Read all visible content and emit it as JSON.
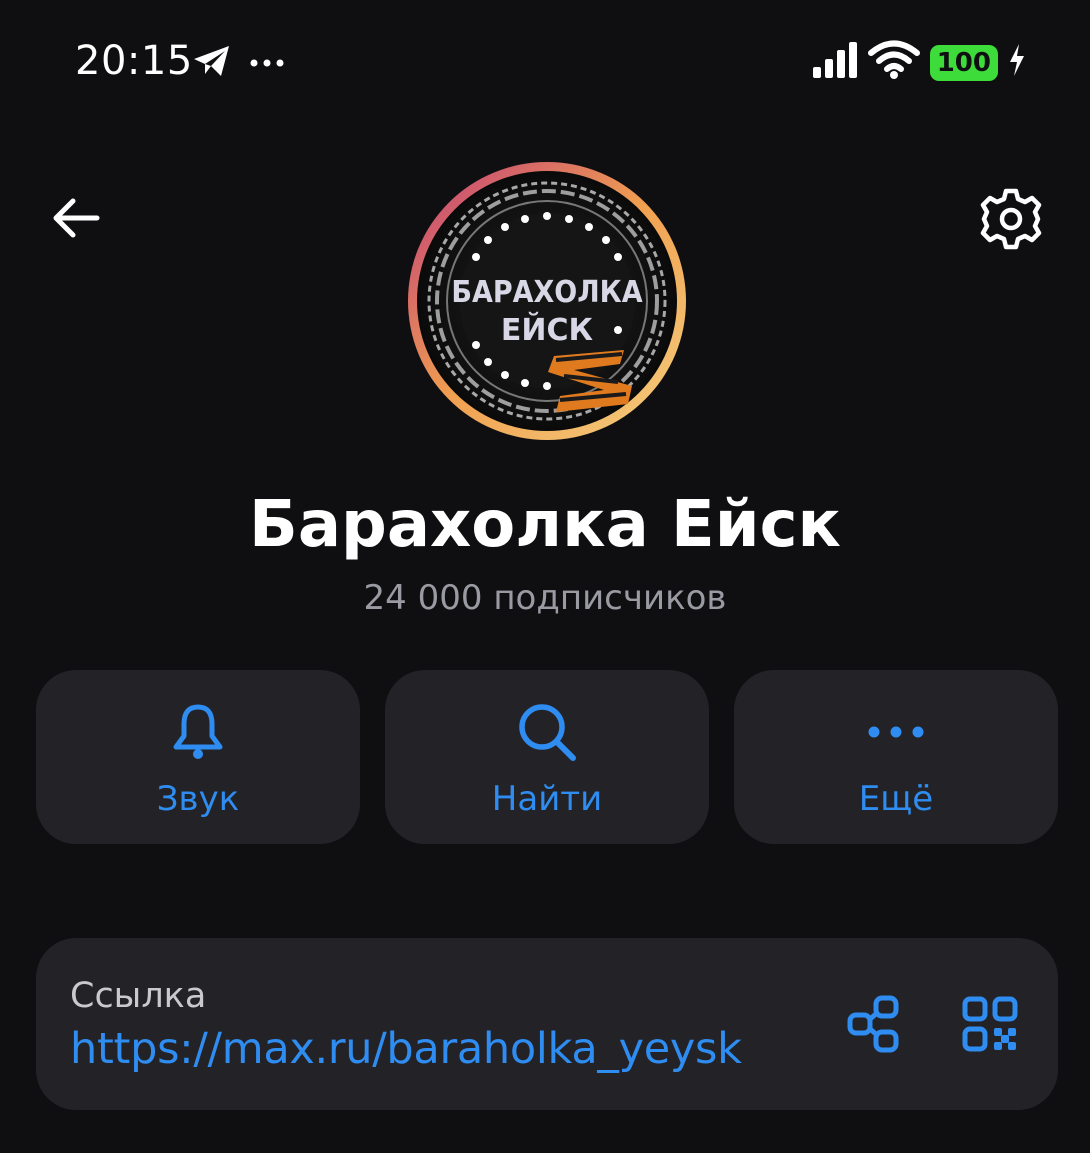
{
  "status_bar": {
    "time": "20:15",
    "left_icons": [
      "telegram-plane-icon",
      "more-dots-icon"
    ],
    "right_icons": [
      "signal-icon",
      "wifi-icon"
    ],
    "battery_level": "100",
    "colors": {
      "battery": "#3ddc3a"
    }
  },
  "header": {
    "back_icon": "arrow-left-icon",
    "settings_icon": "gear-icon"
  },
  "channel": {
    "avatar_text_line1": "БАРАХОЛКА",
    "avatar_text_line2": "ЕЙСК",
    "title": "Барахолка Ейск",
    "subtitle": "24 000 подписчиков"
  },
  "actions": [
    {
      "label": "Звук",
      "icon": "bell-icon"
    },
    {
      "label": "Найти",
      "icon": "search-icon"
    },
    {
      "label": "Ещё",
      "icon": "more-dots-icon"
    }
  ],
  "link": {
    "label": "Ссылка",
    "url": "https://max.ru/baraholka_yeysk",
    "share_icon": "share-icon",
    "qr_icon": "qr-code-icon"
  },
  "colors": {
    "background": "#0f0f12",
    "card": "#222227",
    "accent": "#2f8cf0",
    "muted_text": "#9a9aa2"
  }
}
